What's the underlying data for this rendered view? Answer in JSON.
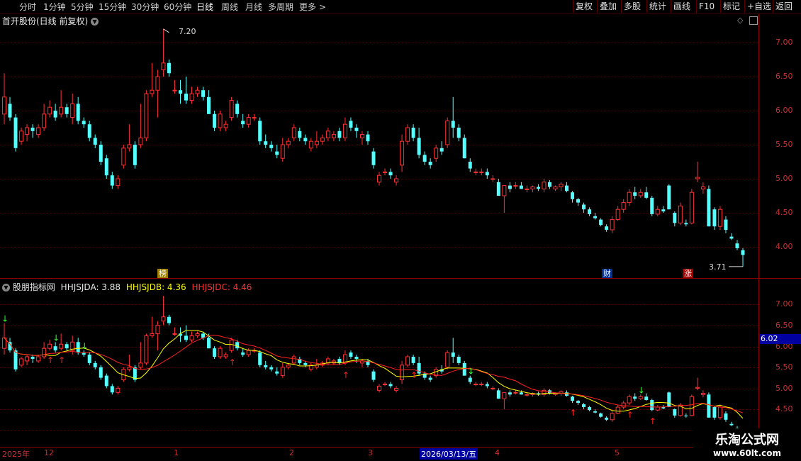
{
  "toolbar": {
    "periods": [
      "分时",
      "1分钟",
      "5分钟",
      "15分钟",
      "30分钟",
      "60分钟",
      "日线",
      "周线",
      "月线",
      "多周期",
      "更多 >"
    ],
    "active_period": "日线",
    "right_buttons": [
      "复权",
      "叠加",
      "多股",
      "统计",
      "画线",
      "F10",
      "标记",
      "+自选",
      "返回"
    ]
  },
  "main_chart": {
    "title": "首开股份(日线 前复权)",
    "high_label": "7.20",
    "low_label": "3.71",
    "y_ticks": [
      "7.00",
      "6.50",
      "6.00",
      "5.50",
      "5.00",
      "4.50",
      "4.00"
    ],
    "badges": [
      "榜",
      "财",
      "涨"
    ]
  },
  "indicator": {
    "name": "股朋指标网",
    "a_label": "HHJSJDA: 3.88",
    "b_label": "HHJSJDB: 4.36",
    "c_label": "HHJSJDC: 4.46",
    "y_ticks": [
      "7.00",
      "6.50",
      "6.00",
      "5.50",
      "5.00",
      "4.50"
    ],
    "cursor_value": "6.02"
  },
  "date_axis": {
    "labels": [
      "2025年",
      "12",
      "1",
      "2",
      "3",
      "2026/03/13/五",
      "4",
      "5"
    ]
  },
  "watermark": {
    "line1": "乐淘公式网",
    "line2": "www.60lt.com"
  },
  "colors": {
    "up": "#ff3232",
    "down": "#54ffff",
    "ma_yellow": "#ffff00",
    "ma_red": "#ff2020",
    "axis": "#c83232"
  },
  "chart_data": {
    "type": "candlestick",
    "title": "首开股份(日线 前复权)",
    "ylim_main": [
      3.6,
      7.4
    ],
    "ylim_indicator": [
      4.2,
      7.4
    ],
    "candles": [
      {
        "o": 5.95,
        "h": 6.55,
        "l": 5.8,
        "c": 6.2
      },
      {
        "o": 6.1,
        "h": 6.2,
        "l": 5.85,
        "c": 5.9
      },
      {
        "o": 5.9,
        "h": 5.95,
        "l": 5.4,
        "c": 5.45
      },
      {
        "o": 5.55,
        "h": 5.75,
        "l": 5.5,
        "c": 5.7
      },
      {
        "o": 5.65,
        "h": 5.8,
        "l": 5.55,
        "c": 5.75
      },
      {
        "o": 5.75,
        "h": 5.8,
        "l": 5.6,
        "c": 5.7
      },
      {
        "o": 5.65,
        "h": 5.8,
        "l": 5.6,
        "c": 5.75
      },
      {
        "o": 5.75,
        "h": 6.1,
        "l": 5.7,
        "c": 5.95
      },
      {
        "o": 5.95,
        "h": 6.15,
        "l": 5.9,
        "c": 6.05
      },
      {
        "o": 6.0,
        "h": 6.1,
        "l": 5.85,
        "c": 5.9
      },
      {
        "o": 5.95,
        "h": 6.3,
        "l": 5.9,
        "c": 6.05
      },
      {
        "o": 6.05,
        "h": 6.1,
        "l": 5.9,
        "c": 5.95
      },
      {
        "o": 5.9,
        "h": 6.25,
        "l": 5.8,
        "c": 6.1
      },
      {
        "o": 6.1,
        "h": 6.2,
        "l": 5.8,
        "c": 5.85
      },
      {
        "o": 5.85,
        "h": 5.9,
        "l": 5.75,
        "c": 5.8
      },
      {
        "o": 5.8,
        "h": 5.85,
        "l": 5.55,
        "c": 5.6
      },
      {
        "o": 5.6,
        "h": 5.65,
        "l": 5.45,
        "c": 5.5
      },
      {
        "o": 5.5,
        "h": 5.55,
        "l": 5.2,
        "c": 5.25
      },
      {
        "o": 5.3,
        "h": 5.35,
        "l": 5.0,
        "c": 5.05
      },
      {
        "o": 5.05,
        "h": 5.1,
        "l": 4.85,
        "c": 4.9
      },
      {
        "o": 4.9,
        "h": 5.05,
        "l": 4.85,
        "c": 5.0
      },
      {
        "o": 5.2,
        "h": 5.5,
        "l": 5.15,
        "c": 5.45
      },
      {
        "o": 5.45,
        "h": 5.8,
        "l": 5.4,
        "c": 5.5
      },
      {
        "o": 5.5,
        "h": 5.55,
        "l": 5.15,
        "c": 5.2
      },
      {
        "o": 5.5,
        "h": 6.1,
        "l": 5.45,
        "c": 5.6
      },
      {
        "o": 5.6,
        "h": 6.3,
        "l": 5.55,
        "c": 6.25
      },
      {
        "o": 6.25,
        "h": 6.7,
        "l": 6.2,
        "c": 6.3
      },
      {
        "o": 6.3,
        "h": 6.6,
        "l": 5.9,
        "c": 6.5
      },
      {
        "o": 6.6,
        "h": 7.2,
        "l": 6.5,
        "c": 6.7
      },
      {
        "o": 6.7,
        "h": 6.75,
        "l": 6.5,
        "c": 6.55
      },
      {
        "o": 6.3,
        "h": 6.45,
        "l": 6.25,
        "c": 6.3
      },
      {
        "o": 6.3,
        "h": 6.45,
        "l": 6.1,
        "c": 6.25
      },
      {
        "o": 6.25,
        "h": 6.5,
        "l": 6.1,
        "c": 6.15
      },
      {
        "o": 6.15,
        "h": 6.35,
        "l": 6.1,
        "c": 6.25
      },
      {
        "o": 6.25,
        "h": 6.35,
        "l": 6.2,
        "c": 6.3
      },
      {
        "o": 6.3,
        "h": 6.35,
        "l": 6.15,
        "c": 6.2
      },
      {
        "o": 6.2,
        "h": 6.3,
        "l": 5.95,
        "c": 5.95
      },
      {
        "o": 5.95,
        "h": 6.0,
        "l": 5.7,
        "c": 5.75
      },
      {
        "o": 5.75,
        "h": 6.0,
        "l": 5.7,
        "c": 5.95
      },
      {
        "o": 5.75,
        "h": 5.85,
        "l": 5.7,
        "c": 5.8
      },
      {
        "o": 5.9,
        "h": 6.2,
        "l": 5.85,
        "c": 6.15
      },
      {
        "o": 6.1,
        "h": 6.15,
        "l": 5.9,
        "c": 5.95
      },
      {
        "o": 5.85,
        "h": 5.95,
        "l": 5.75,
        "c": 5.8
      },
      {
        "o": 5.8,
        "h": 5.95,
        "l": 5.75,
        "c": 5.9
      },
      {
        "o": 5.9,
        "h": 5.95,
        "l": 5.85,
        "c": 5.9
      },
      {
        "o": 5.85,
        "h": 5.9,
        "l": 5.5,
        "c": 5.55
      },
      {
        "o": 5.55,
        "h": 5.65,
        "l": 5.45,
        "c": 5.5
      },
      {
        "o": 5.5,
        "h": 5.55,
        "l": 5.4,
        "c": 5.45
      },
      {
        "o": 5.4,
        "h": 5.5,
        "l": 5.3,
        "c": 5.35
      },
      {
        "o": 5.3,
        "h": 5.6,
        "l": 5.25,
        "c": 5.5
      },
      {
        "o": 5.5,
        "h": 5.6,
        "l": 5.45,
        "c": 5.55
      },
      {
        "o": 5.6,
        "h": 5.8,
        "l": 5.55,
        "c": 5.75
      },
      {
        "o": 5.7,
        "h": 5.75,
        "l": 5.55,
        "c": 5.6
      },
      {
        "o": 5.6,
        "h": 5.65,
        "l": 5.5,
        "c": 5.55
      },
      {
        "o": 5.45,
        "h": 5.6,
        "l": 5.4,
        "c": 5.55
      },
      {
        "o": 5.5,
        "h": 5.7,
        "l": 5.45,
        "c": 5.55
      },
      {
        "o": 5.55,
        "h": 5.65,
        "l": 5.5,
        "c": 5.6
      },
      {
        "o": 5.6,
        "h": 5.75,
        "l": 5.55,
        "c": 5.7
      },
      {
        "o": 5.6,
        "h": 5.7,
        "l": 5.55,
        "c": 5.65
      },
      {
        "o": 5.7,
        "h": 5.75,
        "l": 5.55,
        "c": 5.6
      },
      {
        "o": 5.6,
        "h": 5.9,
        "l": 5.55,
        "c": 5.8
      },
      {
        "o": 5.85,
        "h": 5.9,
        "l": 5.7,
        "c": 5.75
      },
      {
        "o": 5.75,
        "h": 5.8,
        "l": 5.6,
        "c": 5.7
      },
      {
        "o": 5.6,
        "h": 5.7,
        "l": 5.5,
        "c": 5.65
      },
      {
        "o": 5.65,
        "h": 5.7,
        "l": 5.5,
        "c": 5.55
      },
      {
        "o": 5.4,
        "h": 5.45,
        "l": 5.15,
        "c": 5.2
      },
      {
        "o": 4.95,
        "h": 5.1,
        "l": 4.9,
        "c": 5.05
      },
      {
        "o": 5.1,
        "h": 5.15,
        "l": 5.05,
        "c": 5.1
      },
      {
        "o": 5.1,
        "h": 5.15,
        "l": 5.0,
        "c": 5.05
      },
      {
        "o": 4.95,
        "h": 5.05,
        "l": 4.9,
        "c": 5.0
      },
      {
        "o": 5.2,
        "h": 5.65,
        "l": 5.1,
        "c": 5.55
      },
      {
        "o": 5.55,
        "h": 5.8,
        "l": 5.5,
        "c": 5.75
      },
      {
        "o": 5.75,
        "h": 5.8,
        "l": 5.55,
        "c": 5.6
      },
      {
        "o": 5.6,
        "h": 5.75,
        "l": 5.3,
        "c": 5.35
      },
      {
        "o": 5.35,
        "h": 5.4,
        "l": 5.2,
        "c": 5.25
      },
      {
        "o": 5.25,
        "h": 5.3,
        "l": 5.15,
        "c": 5.2
      },
      {
        "o": 5.3,
        "h": 5.5,
        "l": 5.25,
        "c": 5.45
      },
      {
        "o": 5.45,
        "h": 5.55,
        "l": 5.35,
        "c": 5.4
      },
      {
        "o": 5.5,
        "h": 5.9,
        "l": 5.45,
        "c": 5.85
      },
      {
        "o": 5.85,
        "h": 6.2,
        "l": 5.6,
        "c": 5.75
      },
      {
        "o": 5.75,
        "h": 5.8,
        "l": 5.55,
        "c": 5.6
      },
      {
        "o": 5.6,
        "h": 5.65,
        "l": 5.3,
        "c": 5.3
      },
      {
        "o": 5.25,
        "h": 5.3,
        "l": 5.1,
        "c": 5.15
      },
      {
        "o": 5.1,
        "h": 5.15,
        "l": 5.05,
        "c": 5.1
      },
      {
        "o": 5.1,
        "h": 5.15,
        "l": 5.05,
        "c": 5.1
      },
      {
        "o": 5.1,
        "h": 5.15,
        "l": 5.0,
        "c": 5.05
      },
      {
        "o": 5.0,
        "h": 5.05,
        "l": 4.95,
        "c": 5.0
      },
      {
        "o": 4.95,
        "h": 5.0,
        "l": 4.75,
        "c": 4.75
      },
      {
        "o": 4.75,
        "h": 4.8,
        "l": 4.5,
        "c": 4.9
      },
      {
        "o": 4.9,
        "h": 4.95,
        "l": 4.8,
        "c": 4.85
      },
      {
        "o": 4.9,
        "h": 4.95,
        "l": 4.85,
        "c": 4.9
      },
      {
        "o": 4.9,
        "h": 4.95,
        "l": 4.85,
        "c": 4.85
      },
      {
        "o": 4.85,
        "h": 4.9,
        "l": 4.8,
        "c": 4.85
      },
      {
        "o": 4.85,
        "h": 4.9,
        "l": 4.8,
        "c": 4.88
      },
      {
        "o": 4.88,
        "h": 4.92,
        "l": 4.82,
        "c": 4.85
      },
      {
        "o": 4.85,
        "h": 5.0,
        "l": 4.8,
        "c": 4.95
      },
      {
        "o": 4.95,
        "h": 4.98,
        "l": 4.85,
        "c": 4.88
      },
      {
        "o": 4.85,
        "h": 4.9,
        "l": 4.82,
        "c": 4.88
      },
      {
        "o": 4.88,
        "h": 4.95,
        "l": 4.82,
        "c": 4.92
      },
      {
        "o": 4.9,
        "h": 4.95,
        "l": 4.8,
        "c": 4.82
      },
      {
        "o": 4.8,
        "h": 4.82,
        "l": 4.65,
        "c": 4.7
      },
      {
        "o": 4.7,
        "h": 4.72,
        "l": 4.6,
        "c": 4.65
      },
      {
        "o": 4.62,
        "h": 4.65,
        "l": 4.5,
        "c": 4.55
      },
      {
        "o": 4.55,
        "h": 4.58,
        "l": 4.45,
        "c": 4.48
      },
      {
        "o": 4.45,
        "h": 4.5,
        "l": 4.4,
        "c": 4.42
      },
      {
        "o": 4.4,
        "h": 4.42,
        "l": 4.3,
        "c": 4.32
      },
      {
        "o": 4.3,
        "h": 4.33,
        "l": 4.22,
        "c": 4.25
      },
      {
        "o": 4.25,
        "h": 4.45,
        "l": 4.2,
        "c": 4.4
      },
      {
        "o": 4.4,
        "h": 4.6,
        "l": 4.38,
        "c": 4.55
      },
      {
        "o": 4.55,
        "h": 4.7,
        "l": 4.5,
        "c": 4.65
      },
      {
        "o": 4.65,
        "h": 4.85,
        "l": 4.6,
        "c": 4.8
      },
      {
        "o": 4.8,
        "h": 4.88,
        "l": 4.7,
        "c": 4.75
      },
      {
        "o": 4.75,
        "h": 4.85,
        "l": 4.72,
        "c": 4.8
      },
      {
        "o": 4.8,
        "h": 4.88,
        "l": 4.7,
        "c": 4.72
      },
      {
        "o": 4.72,
        "h": 4.75,
        "l": 4.45,
        "c": 4.48
      },
      {
        "o": 4.48,
        "h": 4.6,
        "l": 4.45,
        "c": 4.55
      },
      {
        "o": 4.55,
        "h": 4.6,
        "l": 4.5,
        "c": 4.52
      },
      {
        "o": 4.9,
        "h": 4.92,
        "l": 4.55,
        "c": 4.55
      },
      {
        "o": 4.5,
        "h": 4.52,
        "l": 4.3,
        "c": 4.35
      },
      {
        "o": 4.35,
        "h": 4.65,
        "l": 4.32,
        "c": 4.6
      },
      {
        "o": 4.35,
        "h": 4.4,
        "l": 4.3,
        "c": 4.33
      },
      {
        "o": 4.35,
        "h": 4.85,
        "l": 4.33,
        "c": 4.8
      },
      {
        "o": 5.0,
        "h": 5.25,
        "l": 4.95,
        "c": 5.02
      },
      {
        "o": 4.85,
        "h": 4.95,
        "l": 4.78,
        "c": 4.88
      },
      {
        "o": 4.85,
        "h": 4.9,
        "l": 4.3,
        "c": 4.3
      },
      {
        "o": 4.55,
        "h": 4.58,
        "l": 4.25,
        "c": 4.3
      },
      {
        "o": 4.3,
        "h": 4.6,
        "l": 4.25,
        "c": 4.55
      },
      {
        "o": 4.4,
        "h": 4.45,
        "l": 4.2,
        "c": 4.25
      },
      {
        "o": 4.15,
        "h": 4.2,
        "l": 4.1,
        "c": 4.12
      },
      {
        "o": 4.05,
        "h": 4.1,
        "l": 3.95,
        "c": 3.98
      },
      {
        "o": 3.95,
        "h": 3.98,
        "l": 3.71,
        "c": 3.88
      }
    ]
  }
}
